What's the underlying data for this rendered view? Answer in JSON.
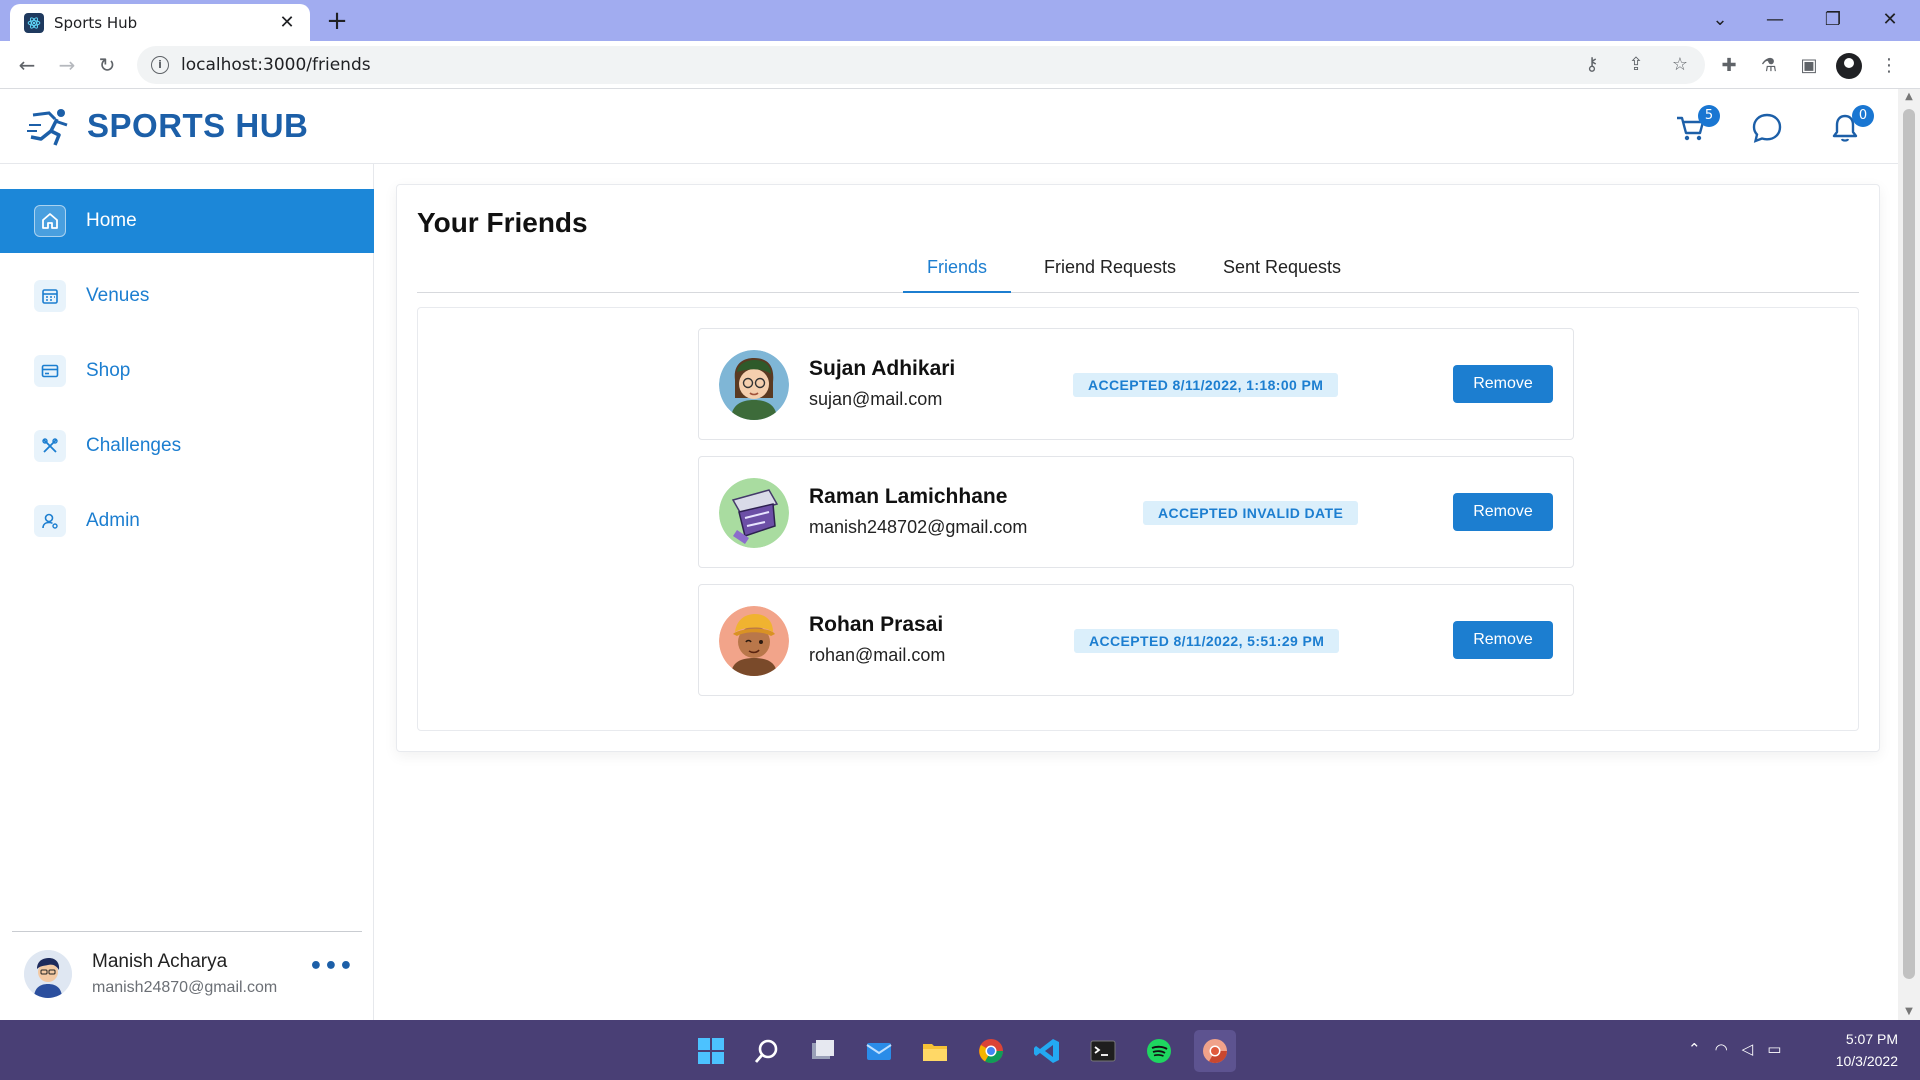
{
  "browser": {
    "tab_title": "Sports Hub",
    "tab_close": "✕",
    "new_tab": "+",
    "url": "localhost:3000/friends",
    "window_controls": {
      "dropdown": "⌄",
      "minimize": "—",
      "restore": "❐",
      "close": "✕"
    }
  },
  "header": {
    "logo_text": "SPORTS HUB",
    "cart_count": "5",
    "notification_count": "0"
  },
  "sidebar": {
    "items": [
      {
        "label": "Home",
        "icon": "home-icon",
        "active": true
      },
      {
        "label": "Venues",
        "icon": "calendar-icon",
        "active": false
      },
      {
        "label": "Shop",
        "icon": "card-icon",
        "active": false
      },
      {
        "label": "Challenges",
        "icon": "challenge-icon",
        "active": false
      },
      {
        "label": "Admin",
        "icon": "admin-icon",
        "active": false
      }
    ],
    "user": {
      "name": "Manish Acharya",
      "email": "manish24870@gmail.com",
      "more": "•••"
    }
  },
  "page": {
    "title": "Your Friends",
    "tabs": [
      {
        "label": "Friends",
        "active": true
      },
      {
        "label": "Friend Requests",
        "active": false
      },
      {
        "label": "Sent Requests",
        "active": false
      }
    ],
    "friends": [
      {
        "name": "Sujan Adhikari",
        "email": "sujan@mail.com",
        "status": "ACCEPTED 8/11/2022, 1:18:00 PM",
        "action": "Remove"
      },
      {
        "name": "Raman Lamichhane",
        "email": "manish248702@gmail.com",
        "status": "ACCEPTED INVALID DATE",
        "action": "Remove"
      },
      {
        "name": "Rohan Prasai",
        "email": "rohan@mail.com",
        "status": "ACCEPTED 8/11/2022, 5:51:29 PM",
        "action": "Remove"
      }
    ]
  },
  "taskbar": {
    "time": "5:07 PM",
    "date": "10/3/2022"
  },
  "colors": {
    "accent": "#1c7ed0",
    "brand": "#1c5fa8",
    "tabstrip": "#a1acf0",
    "taskbar": "#493f75"
  }
}
